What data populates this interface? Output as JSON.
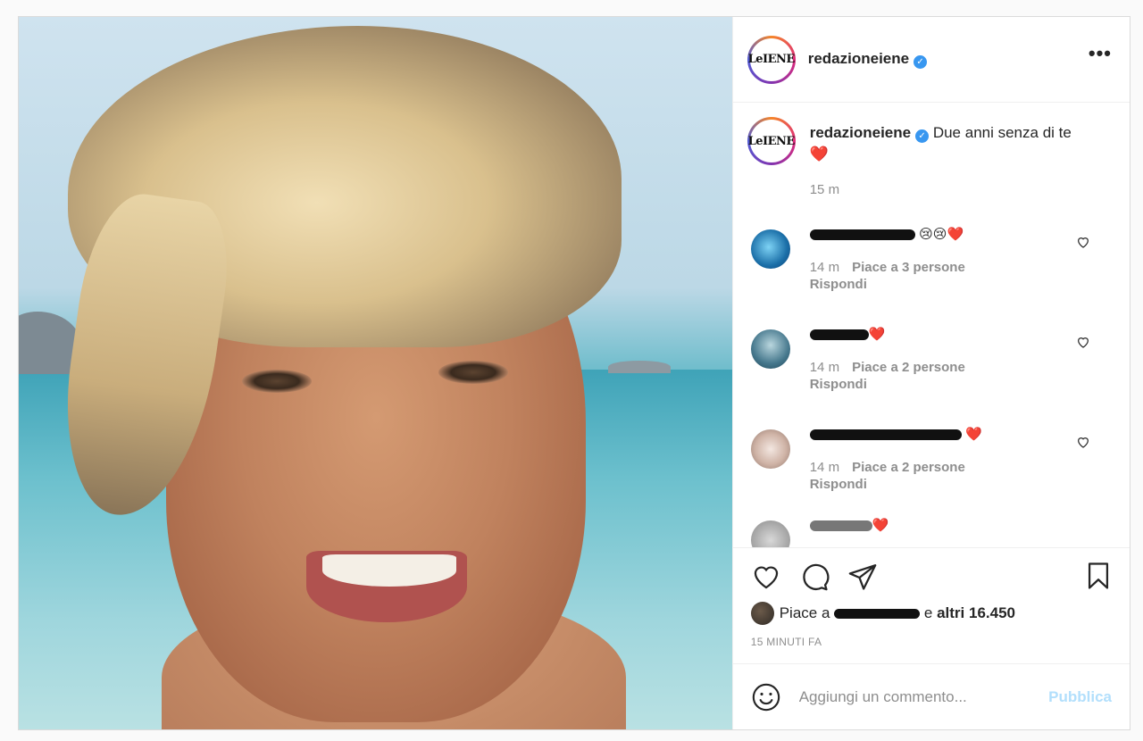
{
  "post": {
    "author": "redazioneiene",
    "logo_text": "LeIENE",
    "more_label": "•••",
    "caption_text": "Due anni senza di te",
    "caption_emoji": "❤️",
    "caption_time": "15 m"
  },
  "comments": [
    {
      "emoji": "😢😢❤️",
      "time": "14 m",
      "likes": "Piace a 3 persone",
      "reply": "Rispondi",
      "avatar_color": "#2c7fb8"
    },
    {
      "emoji": "❤️",
      "time": "14 m",
      "likes": "Piace a 2 persone",
      "reply": "Rispondi",
      "avatar_color": "#3a6e86"
    },
    {
      "emoji": "❤️",
      "time": "14 m",
      "likes": "Piace a 2 persone",
      "reply": "Rispondi",
      "avatar_color": "#c9b2a6"
    },
    {
      "emoji": "❤️",
      "avatar_color": "#9a9a9a"
    }
  ],
  "likes": {
    "prefix": "Piace a",
    "suffix": "e",
    "others": "altri 16.450"
  },
  "posted_when": "15 MINUTI FA",
  "add_comment": {
    "placeholder": "Aggiungi un commento...",
    "publish": "Pubblica"
  },
  "colors": {
    "verified": "#3897f0",
    "publish_disabled": "#b2dffc"
  },
  "icons": [
    "heart-icon",
    "comment-icon",
    "share-icon",
    "bookmark-icon",
    "emoji-icon",
    "more-icon",
    "verified-icon"
  ]
}
